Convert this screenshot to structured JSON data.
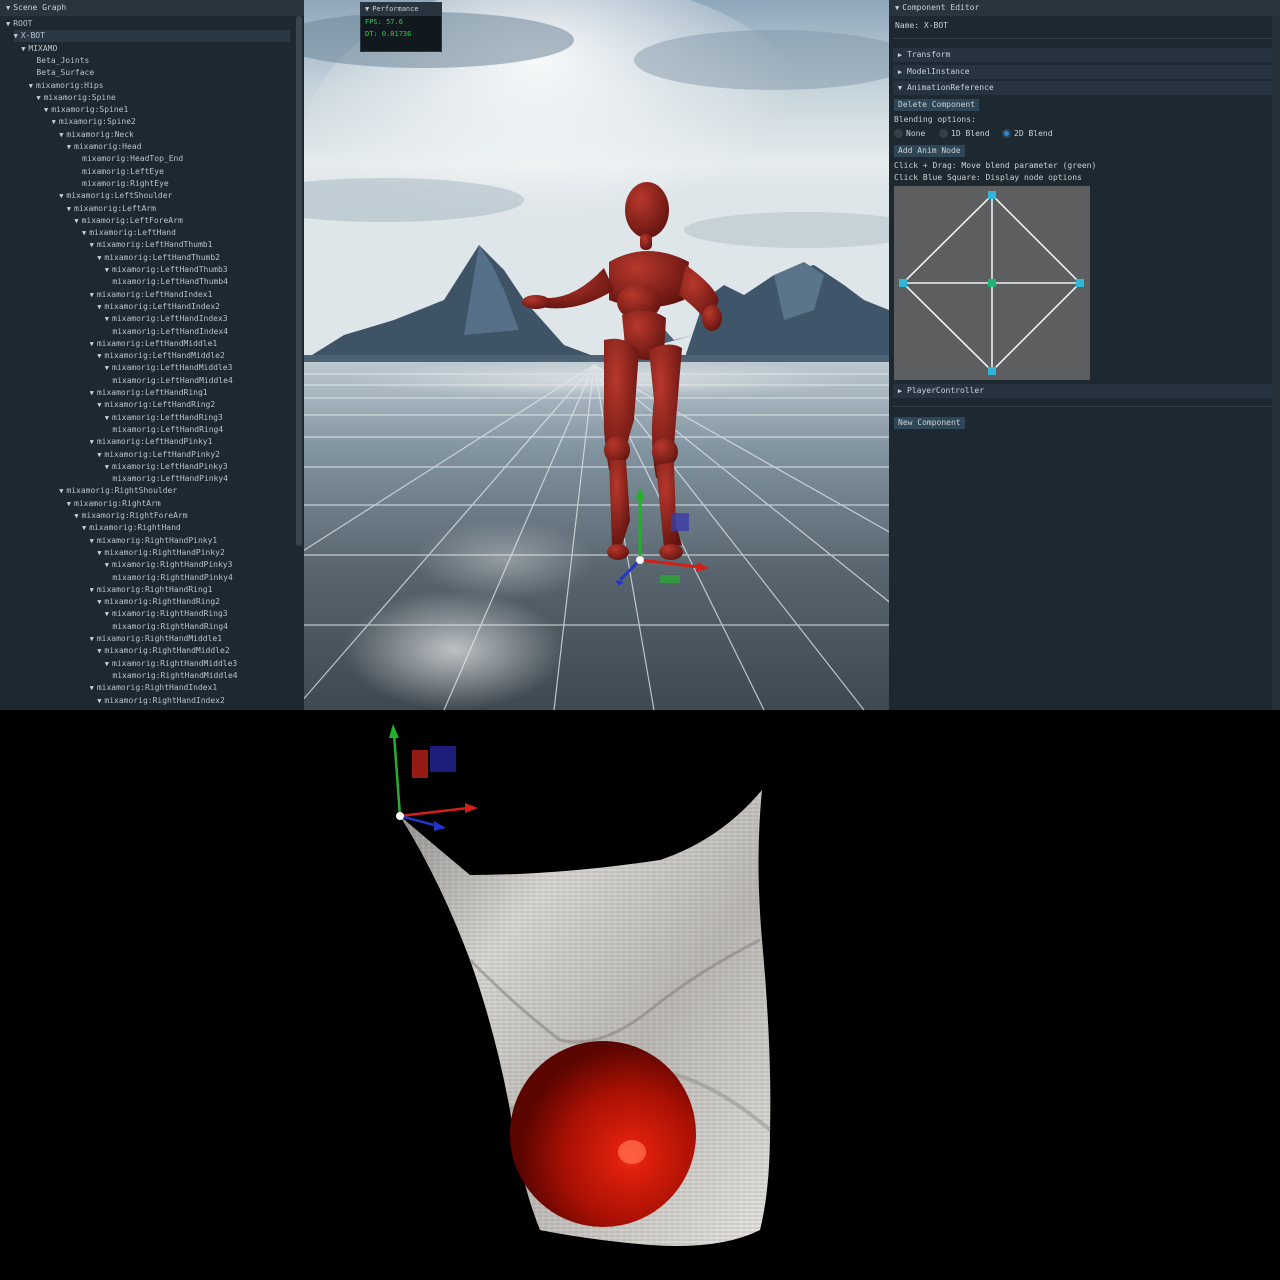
{
  "scene_graph": {
    "title": "Scene Graph",
    "nodes": [
      {
        "label": "ROOT",
        "depth": 0,
        "arrow": true
      },
      {
        "label": "X-BOT",
        "depth": 1,
        "arrow": true,
        "selected": true
      },
      {
        "label": "MIXAMO",
        "depth": 2,
        "arrow": true
      },
      {
        "label": "Beta_Joints",
        "depth": 4,
        "arrow": false
      },
      {
        "label": "Beta_Surface",
        "depth": 4,
        "arrow": false
      },
      {
        "label": "mixamorig:Hips",
        "depth": 3,
        "arrow": true
      },
      {
        "label": "mixamorig:Spine",
        "depth": 4,
        "arrow": true
      },
      {
        "label": "mixamorig:Spine1",
        "depth": 5,
        "arrow": true
      },
      {
        "label": "mixamorig:Spine2",
        "depth": 6,
        "arrow": true
      },
      {
        "label": "mixamorig:Neck",
        "depth": 7,
        "arrow": true
      },
      {
        "label": "mixamorig:Head",
        "depth": 8,
        "arrow": true
      },
      {
        "label": "mixamorig:HeadTop_End",
        "depth": 10,
        "arrow": false
      },
      {
        "label": "mixamorig:LeftEye",
        "depth": 10,
        "arrow": false
      },
      {
        "label": "mixamorig:RightEye",
        "depth": 10,
        "arrow": false
      },
      {
        "label": "mixamorig:LeftShoulder",
        "depth": 7,
        "arrow": true
      },
      {
        "label": "mixamorig:LeftArm",
        "depth": 8,
        "arrow": true
      },
      {
        "label": "mixamorig:LeftForeArm",
        "depth": 9,
        "arrow": true
      },
      {
        "label": "mixamorig:LeftHand",
        "depth": 10,
        "arrow": true
      },
      {
        "label": "mixamorig:LeftHandThumb1",
        "depth": 11,
        "arrow": true
      },
      {
        "label": "mixamorig:LeftHandThumb2",
        "depth": 12,
        "arrow": true
      },
      {
        "label": "mixamorig:LeftHandThumb3",
        "depth": 13,
        "arrow": true
      },
      {
        "label": "mixamorig:LeftHandThumb4",
        "depth": 14,
        "arrow": false
      },
      {
        "label": "mixamorig:LeftHandIndex1",
        "depth": 11,
        "arrow": true
      },
      {
        "label": "mixamorig:LeftHandIndex2",
        "depth": 12,
        "arrow": true
      },
      {
        "label": "mixamorig:LeftHandIndex3",
        "depth": 13,
        "arrow": true
      },
      {
        "label": "mixamorig:LeftHandIndex4",
        "depth": 14,
        "arrow": false
      },
      {
        "label": "mixamorig:LeftHandMiddle1",
        "depth": 11,
        "arrow": true
      },
      {
        "label": "mixamorig:LeftHandMiddle2",
        "depth": 12,
        "arrow": true
      },
      {
        "label": "mixamorig:LeftHandMiddle3",
        "depth": 13,
        "arrow": true
      },
      {
        "label": "mixamorig:LeftHandMiddle4",
        "depth": 14,
        "arrow": false
      },
      {
        "label": "mixamorig:LeftHandRing1",
        "depth": 11,
        "arrow": true
      },
      {
        "label": "mixamorig:LeftHandRing2",
        "depth": 12,
        "arrow": true
      },
      {
        "label": "mixamorig:LeftHandRing3",
        "depth": 13,
        "arrow": true
      },
      {
        "label": "mixamorig:LeftHandRing4",
        "depth": 14,
        "arrow": false
      },
      {
        "label": "mixamorig:LeftHandPinky1",
        "depth": 11,
        "arrow": true
      },
      {
        "label": "mixamorig:LeftHandPinky2",
        "depth": 12,
        "arrow": true
      },
      {
        "label": "mixamorig:LeftHandPinky3",
        "depth": 13,
        "arrow": true
      },
      {
        "label": "mixamorig:LeftHandPinky4",
        "depth": 14,
        "arrow": false
      },
      {
        "label": "mixamorig:RightShoulder",
        "depth": 7,
        "arrow": true
      },
      {
        "label": "mixamorig:RightArm",
        "depth": 8,
        "arrow": true
      },
      {
        "label": "mixamorig:RightForeArm",
        "depth": 9,
        "arrow": true
      },
      {
        "label": "mixamorig:RightHand",
        "depth": 10,
        "arrow": true
      },
      {
        "label": "mixamorig:RightHandPinky1",
        "depth": 11,
        "arrow": true
      },
      {
        "label": "mixamorig:RightHandPinky2",
        "depth": 12,
        "arrow": true
      },
      {
        "label": "mixamorig:RightHandPinky3",
        "depth": 13,
        "arrow": true
      },
      {
        "label": "mixamorig:RightHandPinky4",
        "depth": 14,
        "arrow": false
      },
      {
        "label": "mixamorig:RightHandRing1",
        "depth": 11,
        "arrow": true
      },
      {
        "label": "mixamorig:RightHandRing2",
        "depth": 12,
        "arrow": true
      },
      {
        "label": "mixamorig:RightHandRing3",
        "depth": 13,
        "arrow": true
      },
      {
        "label": "mixamorig:RightHandRing4",
        "depth": 14,
        "arrow": false
      },
      {
        "label": "mixamorig:RightHandMiddle1",
        "depth": 11,
        "arrow": true
      },
      {
        "label": "mixamorig:RightHandMiddle2",
        "depth": 12,
        "arrow": true
      },
      {
        "label": "mixamorig:RightHandMiddle3",
        "depth": 13,
        "arrow": true
      },
      {
        "label": "mixamorig:RightHandMiddle4",
        "depth": 14,
        "arrow": false
      },
      {
        "label": "mixamorig:RightHandIndex1",
        "depth": 11,
        "arrow": true
      },
      {
        "label": "mixamorig:RightHandIndex2",
        "depth": 12,
        "arrow": true
      }
    ]
  },
  "performance": {
    "title": "Performance",
    "fps": "FPS: 57.6",
    "dt": "DT: 0.01736"
  },
  "component_editor": {
    "title": "Component Editor",
    "name": "Name: X-BOT",
    "sections": {
      "transform": "Transform",
      "model_instance": "ModelInstance",
      "animation_reference": "AnimationReference",
      "player_controller": "PlayerController"
    },
    "delete_button": "Delete Component",
    "blending_label": "Blending options:",
    "blend_options": [
      "None",
      "1D Blend",
      "2D Blend"
    ],
    "selected_blend": "2D Blend",
    "add_anim_button": "Add Anim Node",
    "help_line1": "Click + Drag: Move blend parameter (green)",
    "help_line2": "Click Blue Square: Display node options",
    "new_component_button": "New Component"
  },
  "colors": {
    "panel_bg": "#1e2830",
    "title_bar": "#28343e",
    "fps_text": "#25d445",
    "blend_node": "#2fb6d8",
    "blend_param": "#22b573",
    "figure": "#8e2019",
    "sphere": "#d01808"
  },
  "icons": [
    "expand-arrow-icon",
    "collapse-arrow-icon",
    "radio-icon",
    "gizmo-icon"
  ]
}
